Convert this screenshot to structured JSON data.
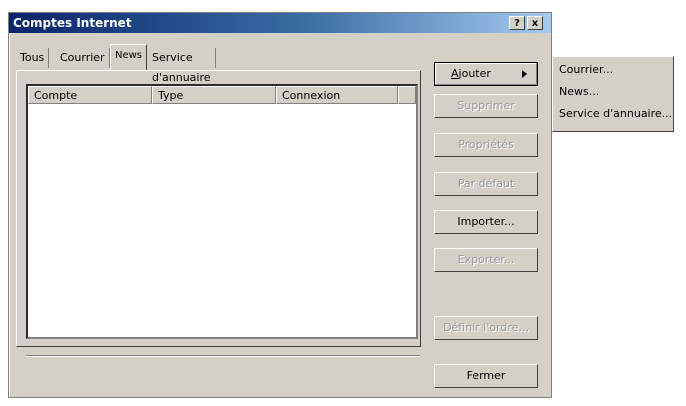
{
  "window": {
    "title": "Comptes Internet",
    "help_button": "?",
    "close_button": "x"
  },
  "tabs": [
    {
      "label": "Tous"
    },
    {
      "label": "Courrier"
    },
    {
      "label": "News"
    },
    {
      "label": "Service d'annuaire"
    }
  ],
  "active_tab": "News",
  "list": {
    "columns": [
      "Compte",
      "Type",
      "Connexion"
    ],
    "rows": []
  },
  "buttons": {
    "ajouter_prefix": "",
    "ajouter_underlined": "A",
    "ajouter_rest": "jouter",
    "supprimer": "Supprimer",
    "proprietes": "Propriétés",
    "par_defaut": "Par défaut",
    "importer": "Importer...",
    "exporter": "Exporter...",
    "definir_ordre": "Définir l'ordre...",
    "fermer": "Fermer"
  },
  "ajouter_menu": [
    "Courrier...",
    "News...",
    "Service d'annuaire..."
  ]
}
